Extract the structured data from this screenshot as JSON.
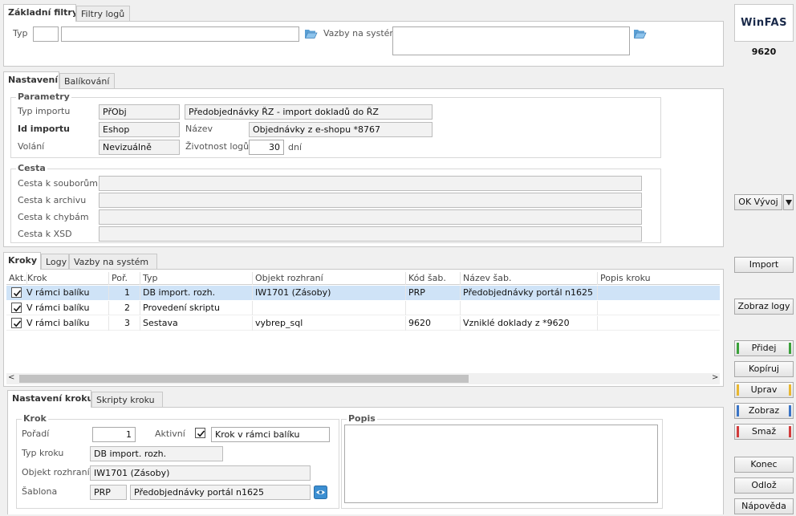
{
  "filters": {
    "tabs": [
      "Základní filtry",
      "Filtry logů"
    ],
    "typ_label": "Typ",
    "typ_code": "",
    "typ_name": "",
    "vazby_label": "Vazby na systém",
    "vazby_value": ""
  },
  "logo": {
    "text": "WinFAS",
    "number": "9620"
  },
  "settings": {
    "tabs": [
      "Nastavení",
      "Balíkování"
    ],
    "params_title": "Parametry",
    "typ_importu_label": "Typ importu",
    "typ_importu_code": "PřObj",
    "typ_importu_name": "Předobjednávky ŘZ - import dokladů do ŘZ",
    "id_importu_label": "Id importu",
    "id_importu_value": "Eshop",
    "nazev_label": "Název",
    "nazev_value": "Objednávky z e-shopu *8767",
    "volani_label": "Volání",
    "volani_value": "Nevizuálně",
    "zivotnost_label": "Životnost logů",
    "zivotnost_value": "30",
    "zivotnost_unit": "dní",
    "cesta_title": "Cesta",
    "cesta_souborum_label": "Cesta k souborům",
    "cesta_archivu_label": "Cesta k archivu",
    "cesta_chybam_label": "Cesta k chybám",
    "cesta_xsd_label": "Cesta k XSD",
    "cesta_souborum": "",
    "cesta_archivu": "",
    "cesta_chybam": "",
    "cesta_xsd": ""
  },
  "steps": {
    "tabs": [
      "Kroky",
      "Logy",
      "Vazby na systém"
    ],
    "columns": [
      "Akt.",
      "Krok",
      "Poř.",
      "Typ",
      "Objekt rozhraní",
      "Kód šab.",
      "Název šab.",
      "Popis kroku"
    ],
    "rows": [
      {
        "checked": true,
        "krok": "V rámci balíku",
        "por": "1",
        "typ": "DB import. rozh.",
        "objekt": "IW1701 (Zásoby)",
        "kod": "PRP",
        "nazev": "Předobjednávky portál n1625",
        "popis": ""
      },
      {
        "checked": true,
        "krok": "V rámci balíku",
        "por": "2",
        "typ": "Provedení skriptu",
        "objekt": "",
        "kod": "",
        "nazev": "",
        "popis": ""
      },
      {
        "checked": true,
        "krok": "V rámci balíku",
        "por": "3",
        "typ": "Sestava",
        "objekt": "vybrep_sql",
        "kod": "9620",
        "nazev": "Vzniklé doklady z *9620",
        "popis": ""
      }
    ]
  },
  "step_settings": {
    "tabs": [
      "Nastavení kroku",
      "Skripty kroku"
    ],
    "krok_title": "Krok",
    "poradi_label": "Pořadí",
    "poradi_value": "1",
    "aktivni_label": "Aktivní",
    "aktivni_text": "Krok v rámci balíku",
    "typ_kroku_label": "Typ kroku",
    "typ_kroku_value": "DB import. rozh.",
    "objekt_label": "Objekt rozhraní",
    "objekt_value": "IW1701 (Zásoby)",
    "sablona_label": "Šablona",
    "sablona_code": "PRP",
    "sablona_name": "Předobjednávky portál n1625",
    "popis_title": "Popis"
  },
  "sidebar": {
    "ok_vyvoj": "OK Vývoj",
    "import": "Import",
    "zobraz_logy": "Zobraz logy",
    "pridej": "Přidej",
    "kopiruj": "Kopíruj",
    "uprav": "Uprav",
    "zobraz": "Zobraz",
    "smaz": "Smaž",
    "konec": "Konec",
    "odloz": "Odlož",
    "napoveda": "Nápověda"
  },
  "colors": {
    "selected_row": "#cfe3f7",
    "green": "#3aa13a",
    "yellow": "#e8b730",
    "blue": "#3a74c6",
    "red": "#d23c3c"
  }
}
